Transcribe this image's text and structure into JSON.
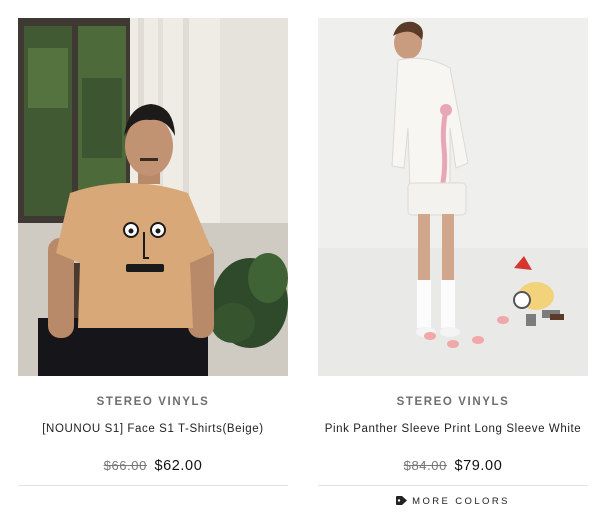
{
  "products": [
    {
      "image_alt": "Man wearing beige T-shirt with face print seated by a window",
      "vendor": "STEREO VINYLS",
      "title": "[NOUNOU S1] Face S1 T-Shirts(Beige)",
      "compare_price": "$66.00",
      "price": "$62.00"
    },
    {
      "image_alt": "Model wearing white long sleeve shirt with Pink Panther print",
      "vendor": "STEREO VINYLS",
      "title": "Pink Panther Sleeve Print Long Sleeve White",
      "compare_price": "$84.00",
      "price": "$79.00",
      "more_colors_label": "MORE COLORS"
    }
  ],
  "icons": {
    "more_colors": "tag-icon"
  },
  "colors": {
    "vendor_text": "#6e6e6e",
    "price_text": "#111111",
    "divider": "#e3e3e3"
  }
}
